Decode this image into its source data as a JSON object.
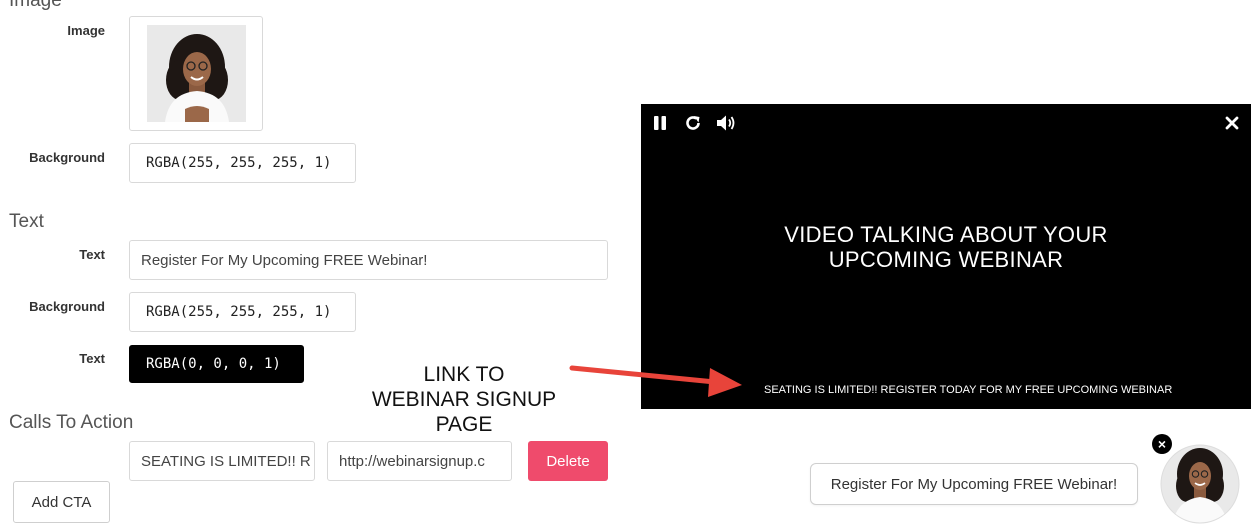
{
  "image_section": {
    "title": "Image",
    "image_label": "Image",
    "background_label": "Background",
    "background_value": "RGBA(255, 255, 255, 1)"
  },
  "text_section": {
    "title": "Text",
    "text_label": "Text",
    "text_value": "Register For My Upcoming FREE Webinar!",
    "background_label": "Background",
    "background_value": "RGBA(255, 255, 255, 1)",
    "color_label": "Text",
    "color_value": "RGBA(0, 0, 0, 1)"
  },
  "cta_section": {
    "title": "Calls To Action",
    "cta_text_value": "SEATING IS LIMITED!! R",
    "cta_url_value": "http://webinarsignup.c",
    "delete_label": "Delete",
    "add_label": "Add CTA"
  },
  "annotation": {
    "line1": "LINK TO",
    "line2": "WEBINAR SIGNUP",
    "line3": "PAGE"
  },
  "video": {
    "message_line1": "VIDEO TALKING ABOUT YOUR",
    "message_line2": "UPCOMING WEBINAR",
    "cta_text": "SEATING IS LIMITED!! REGISTER TODAY FOR MY FREE UPCOMING WEBINAR",
    "icons": [
      "pause-icon",
      "replay-icon",
      "volume-icon",
      "close-icon"
    ]
  },
  "widget": {
    "button_label": "Register For My Upcoming FREE Webinar!",
    "close_symbol": "×"
  },
  "colors": {
    "delete_button": "#ef4b6c",
    "arrow": "#e8443a",
    "video_background": "#000000"
  }
}
